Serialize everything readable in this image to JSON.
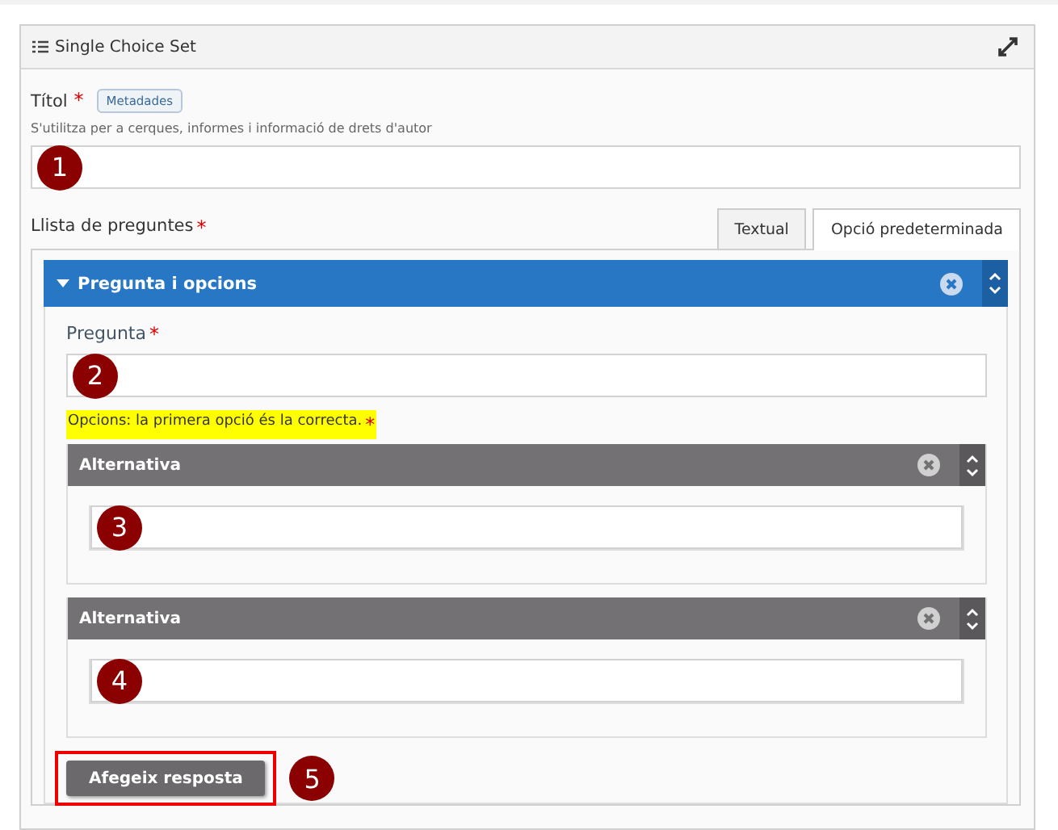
{
  "panel": {
    "title": "Single Choice Set"
  },
  "title_field": {
    "label": "Títol",
    "asterisk": "*",
    "tag": "Metadades",
    "description": "S'utilitza per a cerques, informes i informació de drets d'autor",
    "marker": "1"
  },
  "question_list": {
    "label": "Llista de preguntes",
    "asterisk": "*",
    "tabs": [
      {
        "label": "Textual",
        "selected": false
      },
      {
        "label": "Opció predeterminada",
        "selected": true
      }
    ],
    "group": {
      "title": "Pregunta i opcions",
      "expanded": true,
      "question": {
        "label": "Pregunta",
        "asterisk": "*",
        "marker": "2"
      },
      "options_label": "Opcions: la primera opció és la correcta.",
      "options_asterisk": "*",
      "alternatives": [
        {
          "title": "Alternativa",
          "marker": "3"
        },
        {
          "title": "Alternativa",
          "marker": "4"
        }
      ],
      "add_button": {
        "label": "Afegeix resposta",
        "marker": "5"
      }
    }
  }
}
